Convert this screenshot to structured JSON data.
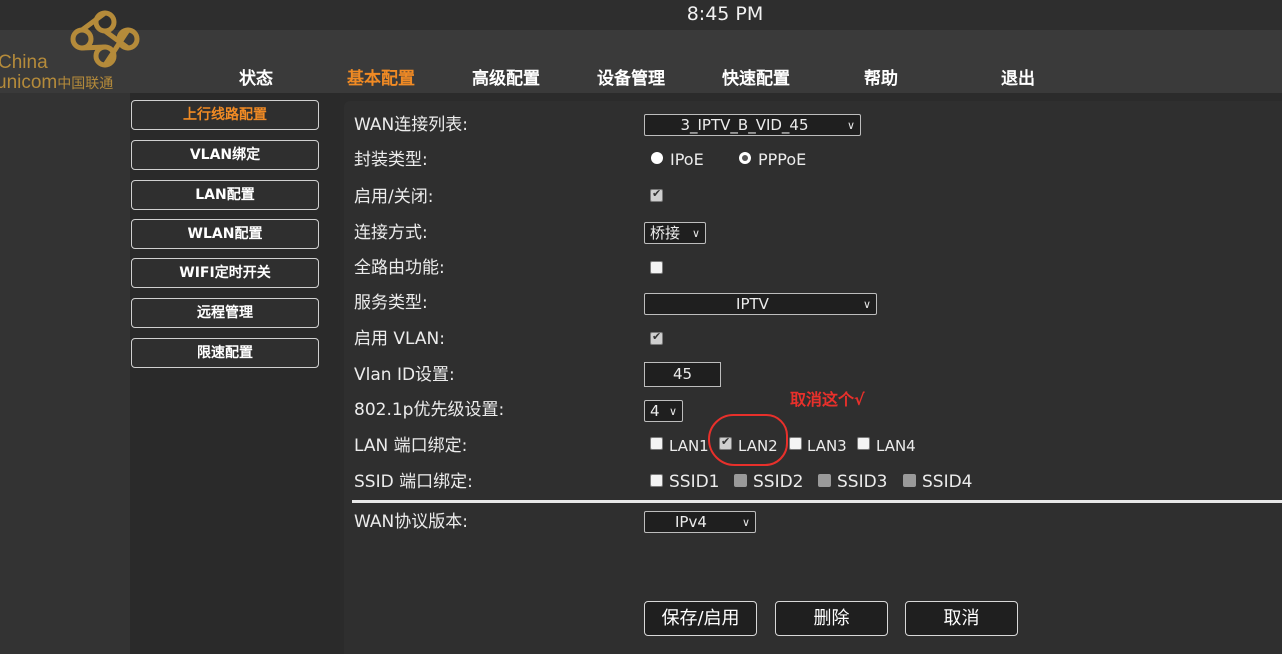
{
  "status_bar": {
    "time": "8:45 PM"
  },
  "logo": {
    "line1": "China",
    "line2": "unicom",
    "line2_cn": "中国联通"
  },
  "nav": [
    "状态",
    "基本配置",
    "高级配置",
    "设备管理",
    "快速配置",
    "帮助",
    "退出"
  ],
  "nav_active": "基本配置",
  "sidebar": [
    "上行线路配置",
    "VLAN绑定",
    "LAN配置",
    "WLAN配置",
    "WIFI定时开关",
    "远程管理",
    "限速配置"
  ],
  "sidebar_active": "上行线路配置",
  "form": {
    "wan_list_label": "WAN连接列表:",
    "wan_list_value": "3_IPTV_B_VID_45",
    "encap_label": "封装类型:",
    "encap_opt1": "IPoE",
    "encap_opt2": "PPPoE",
    "encap_selected": "PPPoE",
    "enable_label": "启用/关闭:",
    "enable_checked": true,
    "conn_mode_label": "连接方式:",
    "conn_mode_value": "桥接",
    "full_route_label": "全路由功能:",
    "full_route_checked": false,
    "service_label": "服务类型:",
    "service_value": "IPTV",
    "vlan_enable_label": "启用 VLAN:",
    "vlan_enable_checked": true,
    "vlan_id_label": "Vlan ID设置:",
    "vlan_id_value": "45",
    "priority_label": "802.1p优先级设置:",
    "priority_value": "4",
    "lan_bind_label": "LAN 端口绑定:",
    "lan_ports": [
      {
        "label": "LAN1",
        "checked": false
      },
      {
        "label": "LAN2",
        "checked": true
      },
      {
        "label": "LAN3",
        "checked": false
      },
      {
        "label": "LAN4",
        "checked": false
      }
    ],
    "ssid_bind_label": "SSID 端口绑定:",
    "ssid_ports": [
      {
        "label": "SSID1",
        "checked": false,
        "disabled": false
      },
      {
        "label": "SSID2",
        "checked": false,
        "disabled": true
      },
      {
        "label": "SSID3",
        "checked": false,
        "disabled": true
      },
      {
        "label": "SSID4",
        "checked": false,
        "disabled": true
      }
    ],
    "wan_proto_label": "WAN协议版本:",
    "wan_proto_value": "IPv4"
  },
  "buttons": {
    "save": "保存/启用",
    "delete": "删除",
    "cancel": "取消"
  },
  "annotation": {
    "text": "取消这个√",
    "color": "#e8302b"
  },
  "colors": {
    "accent": "#f08a24",
    "background": "#2b2b2b"
  }
}
